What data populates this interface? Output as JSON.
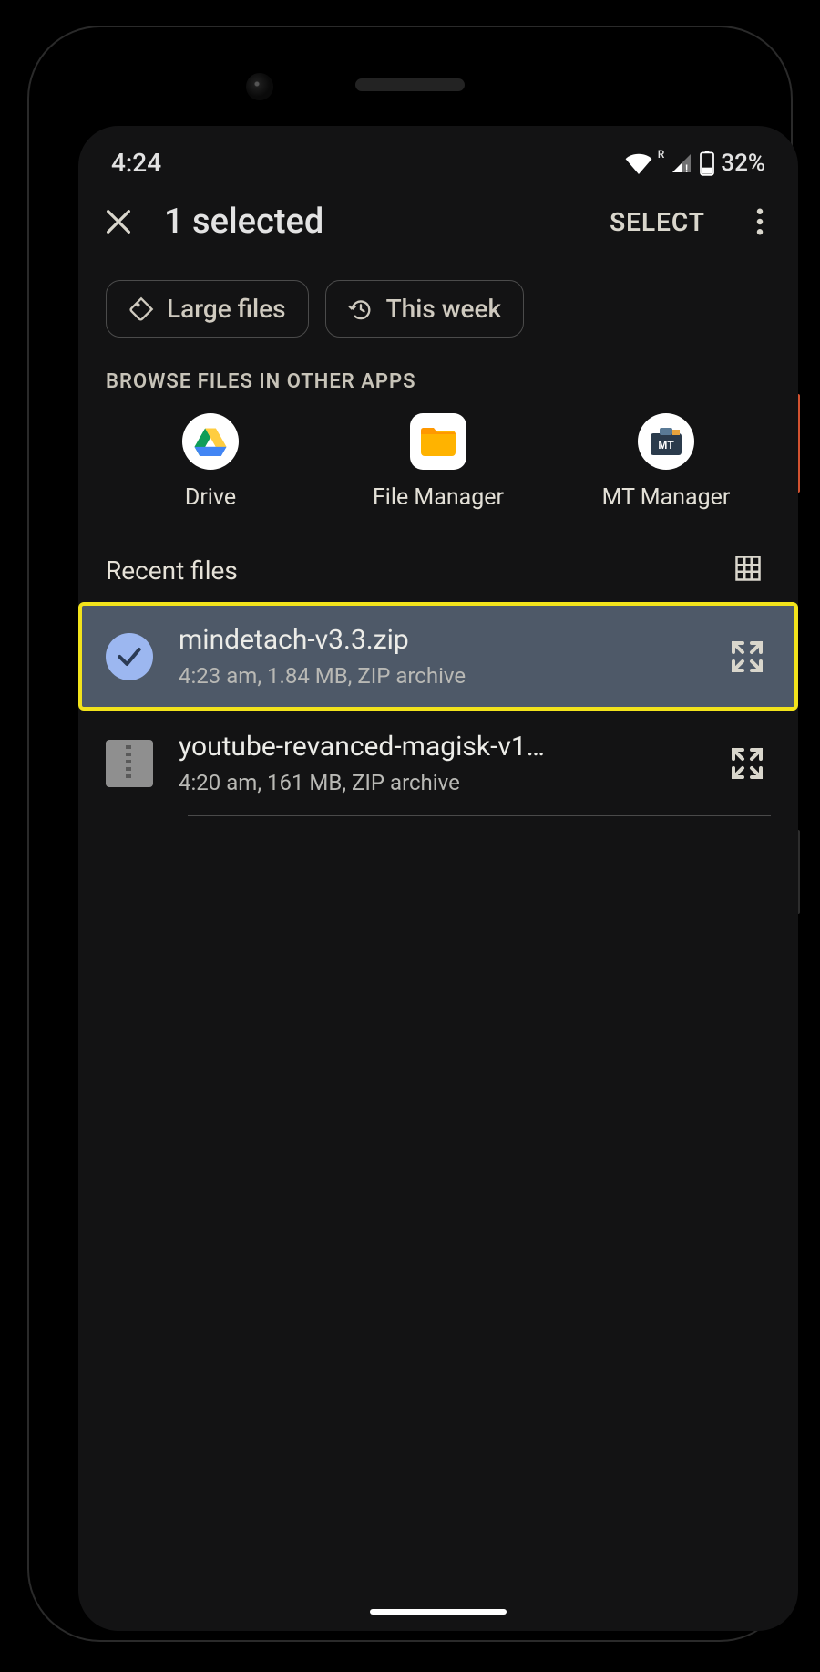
{
  "statusbar": {
    "time": "4:24",
    "battery": "32%",
    "roaming": "R"
  },
  "appbar": {
    "title": "1 selected",
    "select": "SELECT"
  },
  "chips": {
    "large_files": "Large files",
    "this_week": "This week"
  },
  "browse_label": "BROWSE FILES IN OTHER APPS",
  "apps": {
    "drive": "Drive",
    "file_manager": "File Manager",
    "mt_manager": "MT Manager"
  },
  "recent": {
    "title": "Recent files"
  },
  "files": [
    {
      "name": "mindetach-v3.3.zip",
      "meta": "4:23 am, 1.84 MB, ZIP archive",
      "selected": true
    },
    {
      "name": "youtube-revanced-magisk-v1…",
      "meta": "4:20 am, 161 MB, ZIP archive",
      "selected": false
    }
  ]
}
